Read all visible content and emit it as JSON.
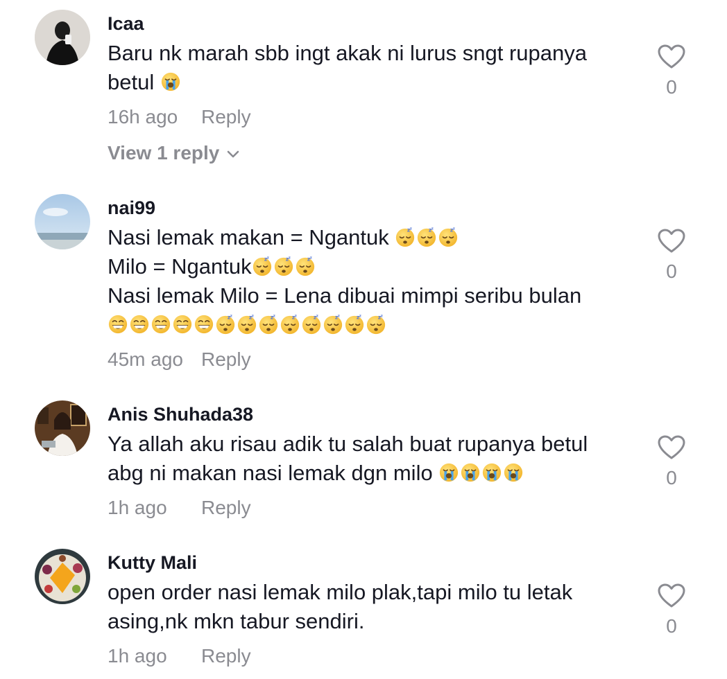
{
  "comments": [
    {
      "username": "Icaa",
      "lines": [
        "Baru nk marah sbb ingt akak ni lurus sngt rupanya",
        "betul "
      ],
      "emoji_line2": [
        "loudly-crying"
      ],
      "time": "16h ago",
      "reply_label": "Reply",
      "like_count": "0",
      "view_replies": "View 1 reply"
    },
    {
      "username": "nai99",
      "lines": [
        "Nasi lemak makan = Ngantuk ",
        "Milo = Ngantuk",
        "Nasi lemak Milo = Lena dibuai mimpi seribu bulan"
      ],
      "time": "45m ago",
      "reply_label": "Reply",
      "like_count": "0"
    },
    {
      "username": "Anis Shuhada38",
      "lines": [
        "Ya allah aku risau adik tu salah buat rupanya betul",
        "abg ni makan nasi lemak dgn milo "
      ],
      "time": "1h ago",
      "reply_label": "Reply",
      "like_count": "0"
    },
    {
      "username": "Kutty Mali",
      "lines": [
        "open order nasi lemak milo plak,tapi milo tu letak",
        "asing,nk mkn tabur sendiri."
      ],
      "time": "1h ago",
      "reply_label": "Reply",
      "like_count": "0"
    }
  ],
  "icons": {
    "like": "heart-outline-icon",
    "expand": "chevron-down-icon",
    "sleeping_emoji": "sleeping-face-emoji",
    "grin_emoji": "grinning-face-emoji",
    "crying_emoji": "loudly-crying-face-emoji"
  },
  "colors": {
    "text_primary": "#161823",
    "text_secondary": "#8a8b91",
    "emoji_yellow": "#f7c539",
    "tear_blue": "#4aa3ea"
  }
}
